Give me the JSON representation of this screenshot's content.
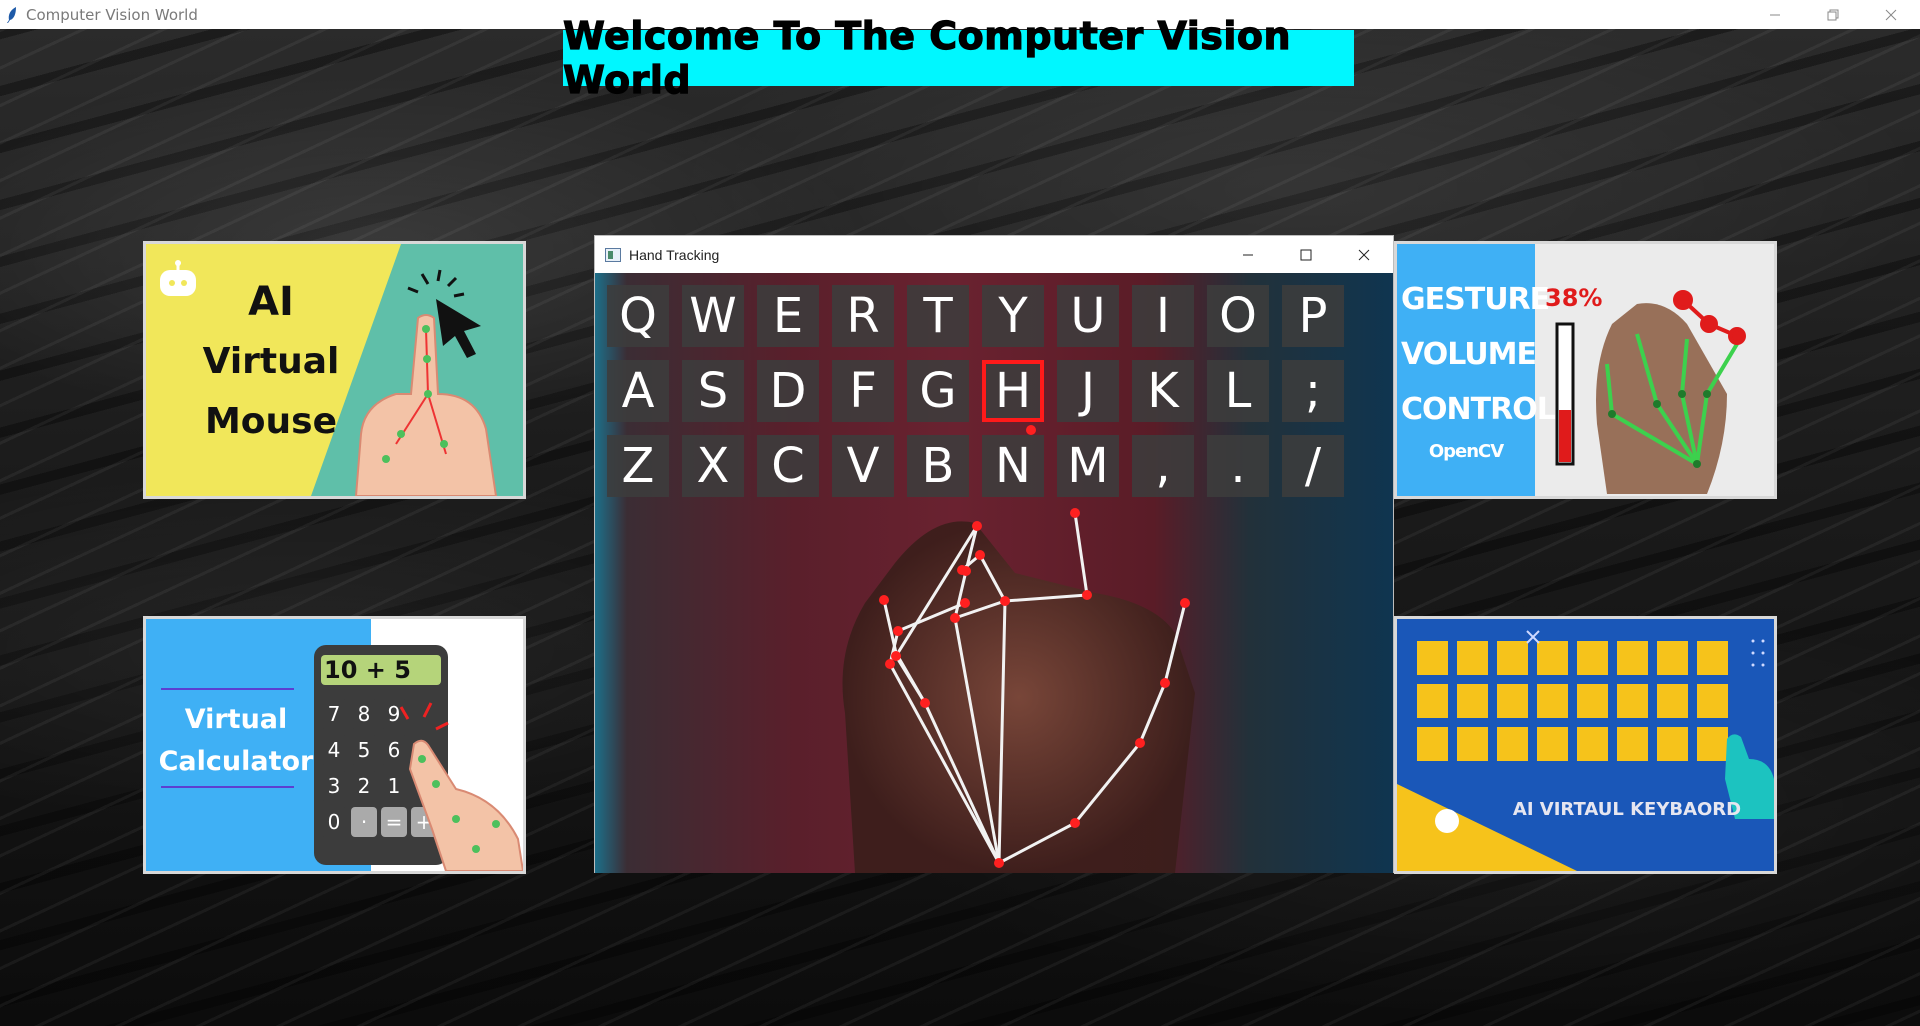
{
  "window": {
    "title": "Computer Vision World"
  },
  "banner": {
    "text": "Welcome To The Computer Vision World"
  },
  "cards": {
    "mouse": {
      "line1": "AI",
      "line2": "Virtual",
      "line3": "Mouse"
    },
    "calculator": {
      "line1": "Virtual",
      "line2": "Calculator",
      "display": "10 + 5",
      "keys": [
        "7",
        "8",
        "9",
        "4",
        "5",
        "6",
        "3",
        "2",
        "1",
        "0",
        "·",
        "=",
        "+"
      ]
    },
    "volume": {
      "line1": "GESTURE",
      "line2": "VOLUME",
      "line3": "CONTROL",
      "line4": "OpenCV",
      "percent": "38%",
      "level": 0.38
    },
    "keyboard": {
      "caption": "AI VIRTAUL KEYBAORD"
    }
  },
  "hand_tracking": {
    "title": "Hand Tracking",
    "selected_key": "H",
    "rows": [
      [
        "Q",
        "W",
        "E",
        "R",
        "T",
        "Y",
        "U",
        "I",
        "O",
        "P"
      ],
      [
        "A",
        "S",
        "D",
        "F",
        "G",
        "H",
        "J",
        "K",
        "L",
        ";"
      ],
      [
        "Z",
        "X",
        "C",
        "V",
        "B",
        "N",
        "M",
        ",",
        ".",
        "/"
      ]
    ]
  },
  "colors": {
    "banner_bg": "#00f7ff",
    "selected_key_border": "#ff1a1a",
    "landmark": "#ff2020",
    "skeleton": "#f2f2f2"
  }
}
